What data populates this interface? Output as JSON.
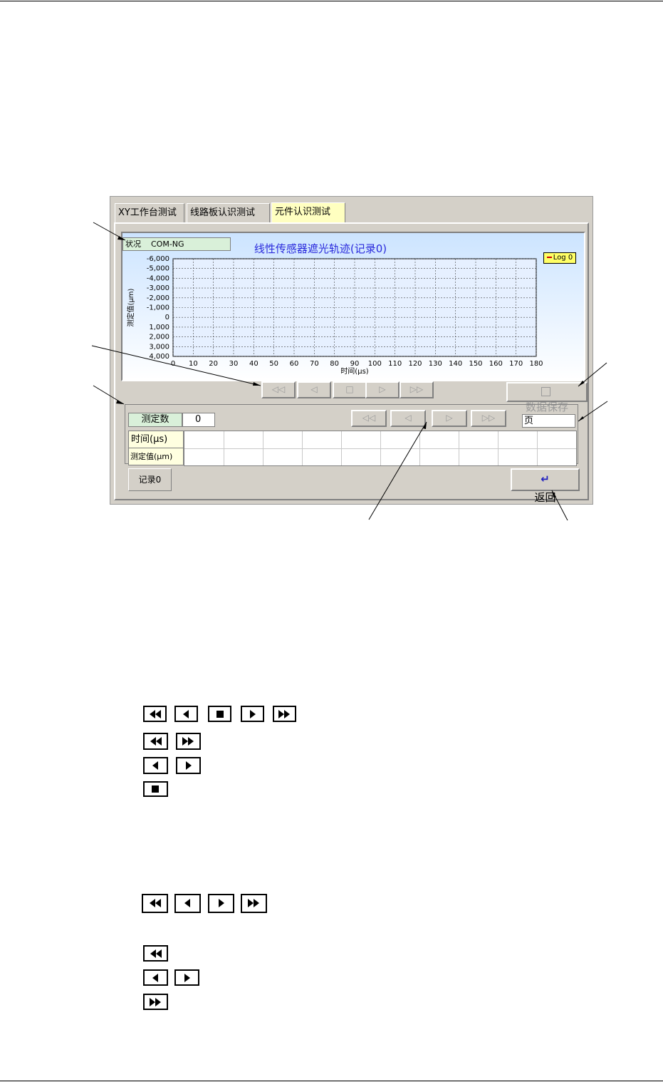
{
  "tabs": [
    "XY工作台测试",
    "线路板认识测试",
    "元件认识测试"
  ],
  "status": {
    "label": "状况",
    "value": "COM-NG"
  },
  "chart_title": "线性传感器遮光轨迹(记录0)",
  "legend": "Log 0",
  "chart_data": {
    "type": "line",
    "title": "线性传感器遮光轨迹(记录0)",
    "xlabel": "时间(μs)",
    "ylabel": "测定值(μm)",
    "xlim": [
      0,
      180
    ],
    "ylim": [
      -6000,
      4000
    ],
    "x_ticks": [
      "0",
      "10",
      "20",
      "30",
      "40",
      "50",
      "60",
      "70",
      "80",
      "90",
      "100",
      "110",
      "120",
      "130",
      "140",
      "150",
      "160",
      "170",
      "180"
    ],
    "y_ticks": [
      "-6,000",
      "-5,000",
      "-4,000",
      "-3,000",
      "-2,000",
      "-1,000",
      "0",
      "1,000",
      "2,000",
      "3,000",
      "4,000"
    ],
    "series": [],
    "grid": true,
    "legend_position": "top-right"
  },
  "chart_nav": [
    "◁◁",
    "◁",
    "□",
    "▷",
    "▷▷"
  ],
  "save_button": "数据保存",
  "table": {
    "count_label": "测定数",
    "count_value": "0",
    "page_label": "页",
    "row_time": "时间(μs)",
    "row_value": "测定值(μm)",
    "nav": [
      "◁◁",
      "◁",
      "▷",
      "▷▷"
    ]
  },
  "record_tab": "记录0",
  "return_button": "返回"
}
